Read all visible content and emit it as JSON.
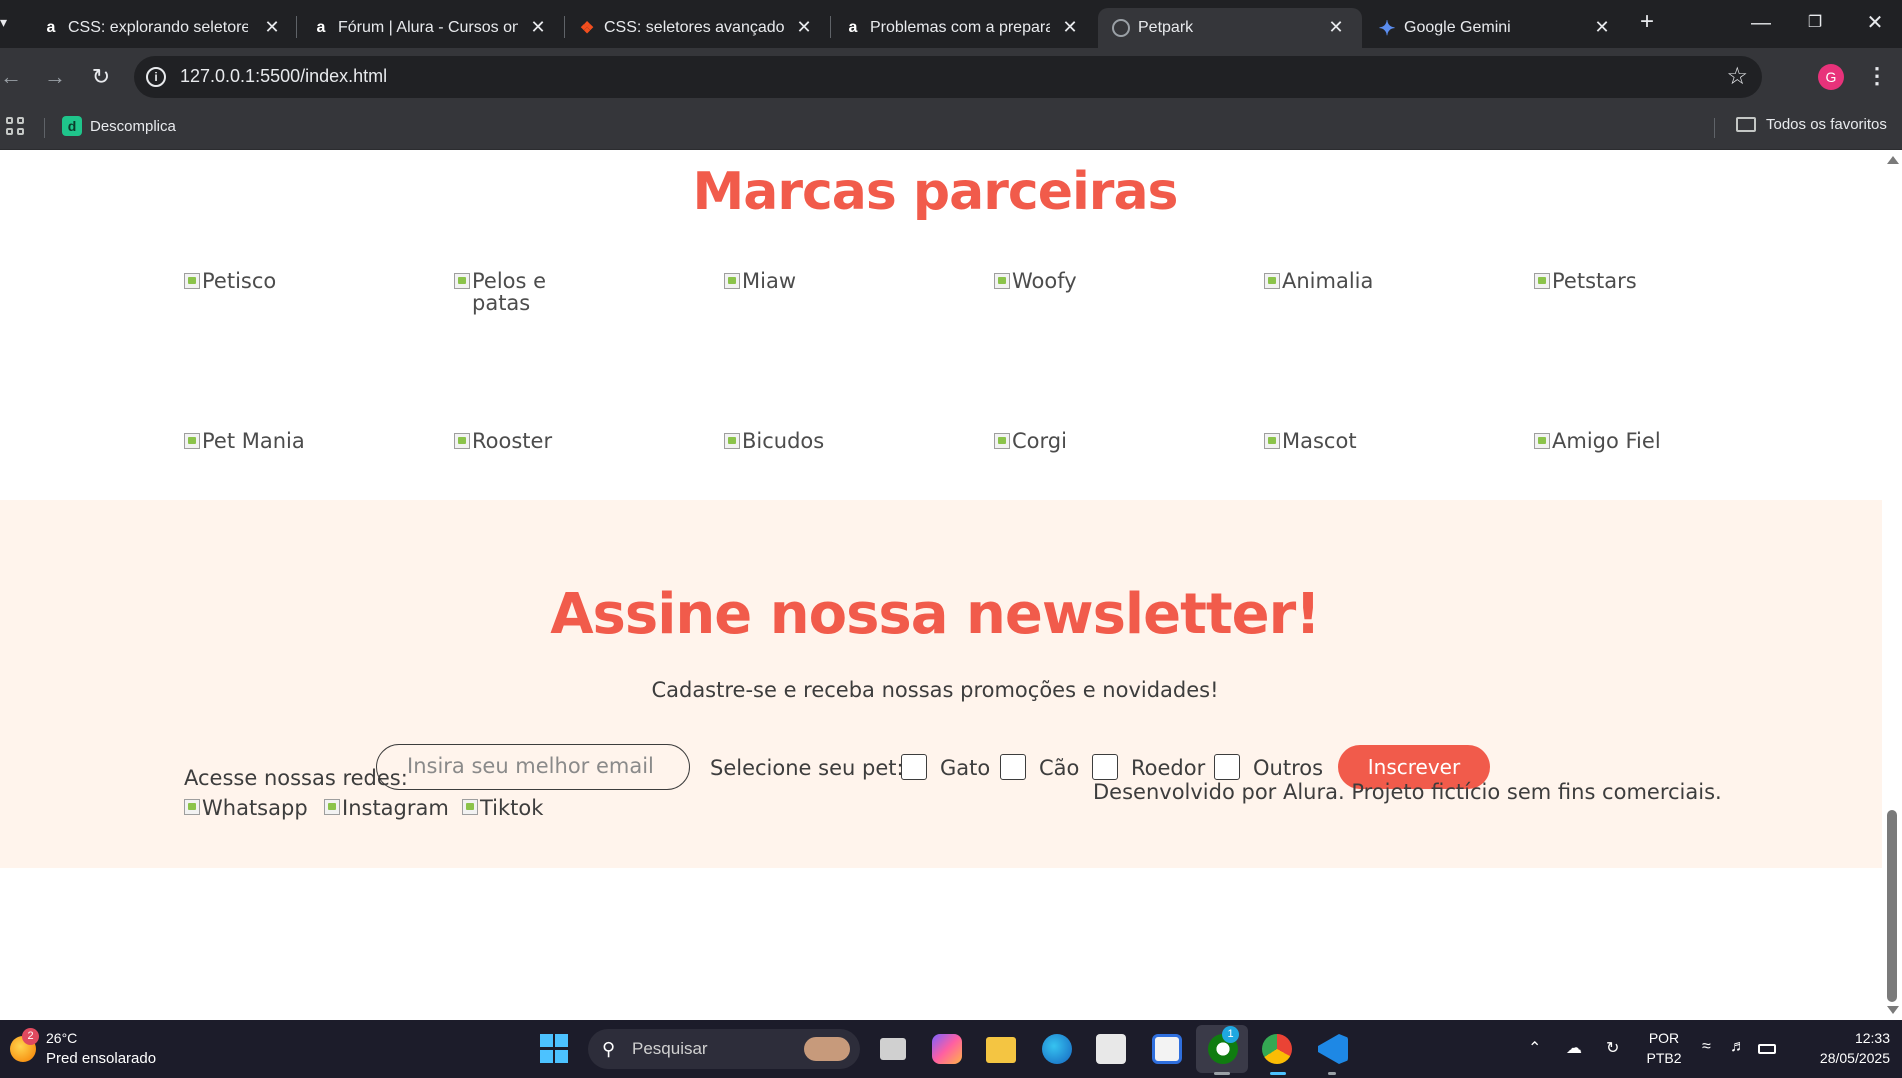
{
  "browser": {
    "tabs": [
      {
        "title": "CSS: explorando seletores",
        "favicon": "alura-icon",
        "active": false
      },
      {
        "title": "Fórum | Alura - Cursos onli",
        "favicon": "alura-icon",
        "active": false
      },
      {
        "title": "CSS: seletores avançados e",
        "favicon": "figma-icon",
        "active": false
      },
      {
        "title": "Problemas com a preparaç",
        "favicon": "alura-icon",
        "active": false
      },
      {
        "title": "Petpark",
        "favicon": "globe-icon",
        "active": true
      },
      {
        "title": "Google Gemini",
        "favicon": "gemini-icon",
        "active": false
      }
    ],
    "url": "127.0.0.1:5500/index.html",
    "profile_initial": "G",
    "bookmarks": [
      {
        "label": "Descomplica"
      }
    ],
    "all_bookmarks_label": "Todos os favoritos"
  },
  "page": {
    "brands_title": "Marcas parceiras",
    "brands": [
      "Petisco",
      "Pelos e patas",
      "Miaw",
      "Woofy",
      "Animalia",
      "Petstars",
      "Pet Mania",
      "Rooster",
      "Bicudos",
      "Corgi",
      "Mascot",
      "Amigo Fiel"
    ],
    "newsletter": {
      "title": "Assine nossa newsletter!",
      "subtitle": "Cadastre-se e receba nossas promoções e novidades!",
      "email_placeholder": "Insira seu melhor email",
      "pet_label": "Selecione seu pet:",
      "pet_options": [
        "Gato",
        "Cão",
        "Roedor",
        "Outros"
      ],
      "button": "Inscrever"
    },
    "footer": {
      "social_label": "Acesse nossas redes:",
      "social": [
        "Whatsapp",
        "Instagram",
        "Tiktok"
      ],
      "credits": "Desenvolvido por Alura. Projeto fictício sem fins comerciais."
    }
  },
  "taskbar": {
    "weather_badge": "2",
    "weather_temp": "26°C",
    "weather_desc": "Pred ensolarado",
    "search_label": "Pesquisar",
    "xbox_badge": "1",
    "lang_top": "POR",
    "lang_bottom": "PTB2",
    "time": "12:33",
    "date": "28/05/2025"
  },
  "colors": {
    "accent": "#f15b4b",
    "newsletter_bg": "#fff4ec",
    "text": "#3d3d3d"
  }
}
